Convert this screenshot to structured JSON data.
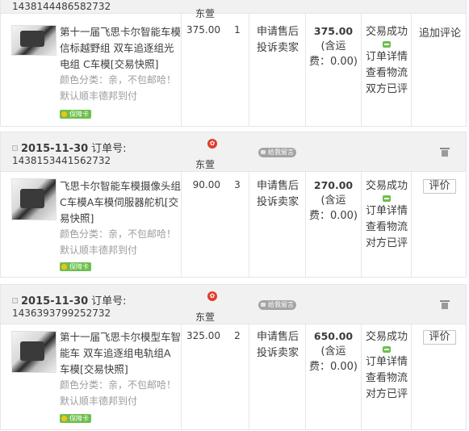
{
  "orders": [
    {
      "order_no": "1438144486582732",
      "shop": "东萱",
      "title": "第十一届飞思卡尔智能车模信标越野组 双车追逐组光电组 C车模[交易快照]",
      "sku_line1": "颜色分类：亲，不包邮哈！",
      "sku_line2": "默认顺丰德邦到付",
      "badge": "保障卡",
      "unit_price": "375.00",
      "qty": "1",
      "after_sale_1": "申请售后",
      "after_sale_2": "投诉卖家",
      "total": "375.00",
      "shipping_1": "(含运",
      "shipping_2": "费：0.00)",
      "status": "交易成功",
      "link_detail": "订单详情",
      "link_logistics": "查看物流",
      "link_review": "双方已评",
      "op": "追加评论"
    },
    {
      "date": "2015-11-30",
      "order_label": "订单号:",
      "order_no": "1438153441562732",
      "shop": "东萱",
      "message_btn": "给我留言",
      "title": "飞思卡尔智能车模摄像头组C车模A车模伺服器舵机[交易快照]",
      "sku_line1": "颜色分类：亲，不包邮哈！",
      "sku_line2": "默认顺丰德邦到付",
      "badge": "保障卡",
      "unit_price": "90.00",
      "qty": "3",
      "after_sale_1": "申请售后",
      "after_sale_2": "投诉卖家",
      "total": "270.00",
      "shipping_1": "(含运",
      "shipping_2": "费：0.00)",
      "status": "交易成功",
      "link_detail": "订单详情",
      "link_logistics": "查看物流",
      "link_review": "对方已评",
      "op": "评价"
    },
    {
      "date": "2015-11-30",
      "order_label": "订单号:",
      "order_no": "1436393799252732",
      "shop": "东萱",
      "message_btn": "给我留言",
      "title": "第十一届飞思卡尔模型车智能车 双车追逐组电轨组A车模[交易快照]",
      "sku_line1": "颜色分类：亲，不包邮哈！",
      "sku_line2": "默认顺丰德邦到付",
      "badge": "保障卡",
      "unit_price": "325.00",
      "qty": "2",
      "after_sale_1": "申请售后",
      "after_sale_2": "投诉卖家",
      "total": "650.00",
      "shipping_1": "(含运",
      "shipping_2": "费：0.00)",
      "status": "交易成功",
      "link_detail": "订单详情",
      "link_logistics": "查看物流",
      "link_review": "对方已评",
      "op": "评价"
    }
  ],
  "icons": {
    "checkbox": "checkbox-icon",
    "shop": "shop-badge-icon",
    "message": "message-icon",
    "trash": "trash-icon",
    "wangwang": "wangwang-chat-icon",
    "guarantee": "guarantee-card-icon"
  },
  "colors": {
    "header_bg": "#f1f1f1",
    "border": "#e6e6e6",
    "muted_text": "#9c9c9c",
    "shop_icon": "#e43b2b",
    "badge_green": "#6cbf4b"
  }
}
